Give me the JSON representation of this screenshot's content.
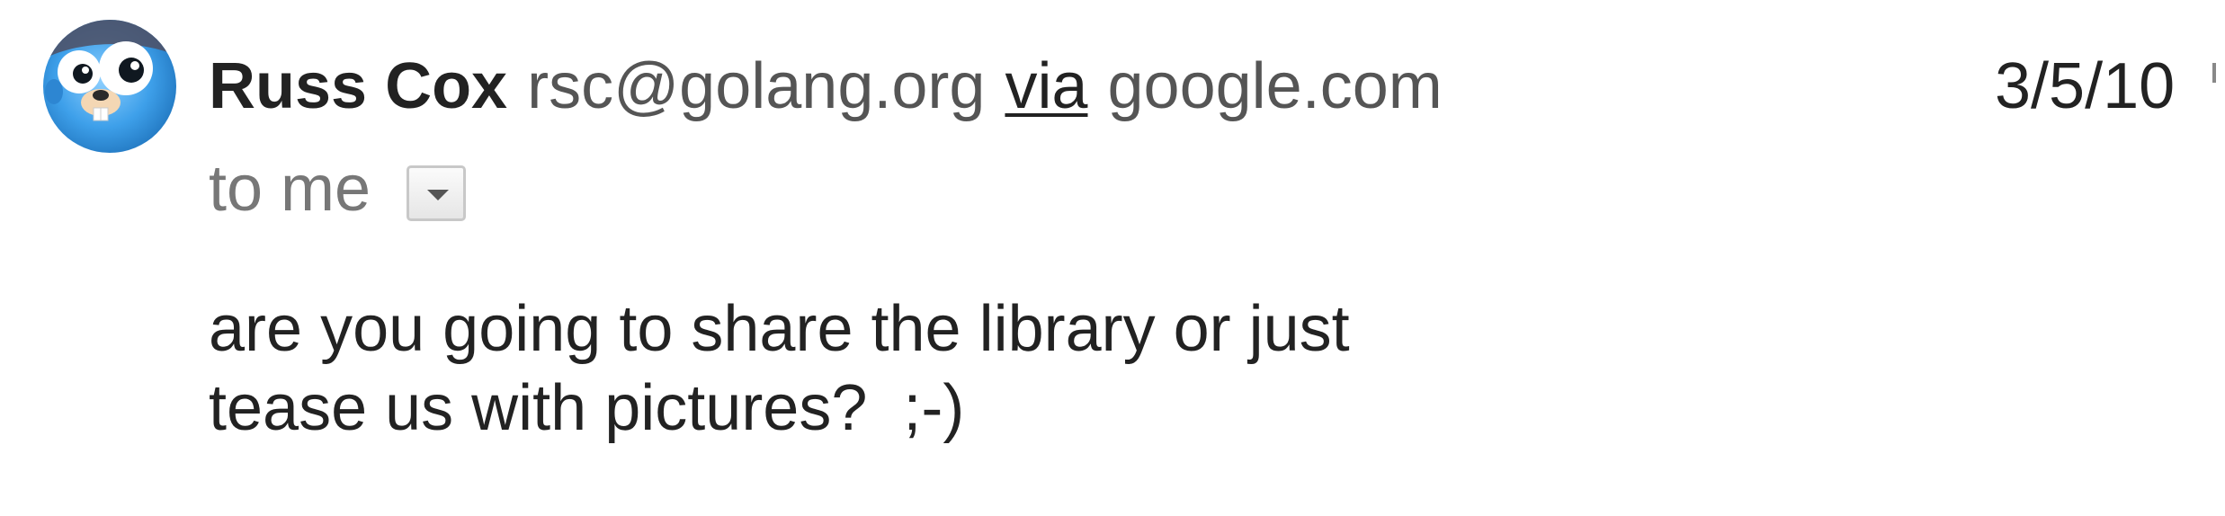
{
  "message": {
    "sender": {
      "name": "Russ Cox",
      "email": "rsc@golang.org",
      "via_label": "via",
      "via_domain": "google.com",
      "avatar": "gopher-avatar"
    },
    "date": "3/5/10",
    "recipients_label": "to me",
    "details_toggle_icon": "chevron-down-icon",
    "body": {
      "lines": [
        "are you going to share the library or just",
        "tease us with pictures?  ;-)"
      ]
    }
  },
  "colors": {
    "text": "#222222",
    "secondary_text": "#555555",
    "muted_text": "#777777",
    "avatar_blue": "#3ea0ea"
  }
}
